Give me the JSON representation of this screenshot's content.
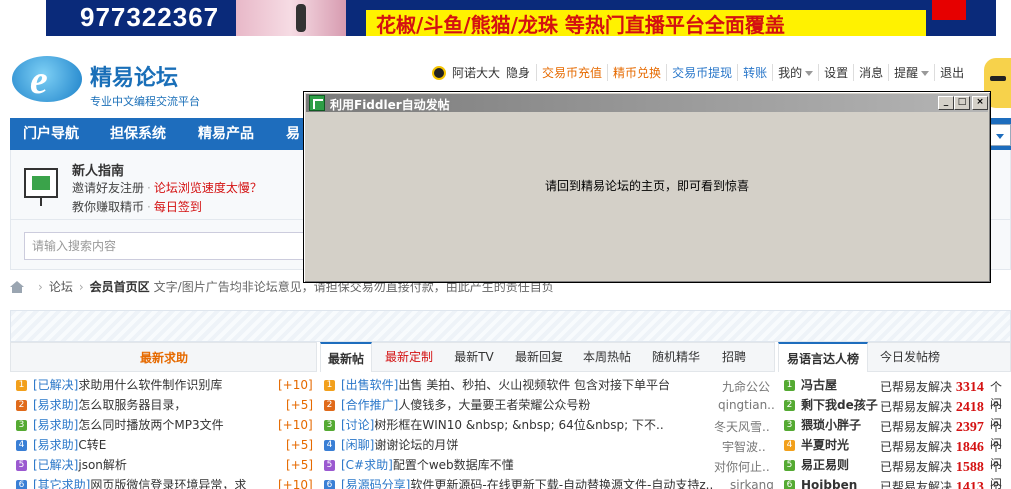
{
  "banner": {
    "phone": "977322367",
    "slogan": "花椒/斗鱼/熊猫/龙珠  等热门直播平台全面覆盖"
  },
  "header": {
    "logo_name": "精易论坛",
    "logo_tagline": "专业中文编程交流平台",
    "username": "阿诺大大",
    "invisible": "隐身",
    "links": [
      "交易币充值",
      "精币兑换",
      "交易币提现",
      "转账",
      "我的",
      "设置",
      "消息",
      "提醒",
      "退出"
    ]
  },
  "nav": {
    "items": [
      "门户导航",
      "担保系统",
      "精易产品",
      "易"
    ]
  },
  "guide": {
    "title": "新人指南",
    "line1_a": "邀请好友注册",
    "line1_b": "论坛浏览速度太慢？",
    "line2_a": "教你赚取精币",
    "line2_b": "每日签到"
  },
  "search": {
    "placeholder": "请输入搜索内容"
  },
  "breadcrumb": {
    "forum": "论坛",
    "section": "会员首页区",
    "notice": "文字/图片广告均非论坛意见，请担保交易勿直接付款，由此产生的责任自负"
  },
  "left_panel": {
    "title": "最新求助",
    "rows": [
      {
        "tag": "[已解决]",
        "text": "求助用什么软件制作识别库",
        "pts": "[+10]"
      },
      {
        "tag": "[易求助]",
        "text": "怎么取服务器目录，",
        "pts": "[+5]"
      },
      {
        "tag": "[易求助]",
        "text": "怎么同时播放两个MP3文件",
        "pts": "[+10]"
      },
      {
        "tag": "[易求助]",
        "text": "C转E",
        "pts": "[+5]"
      },
      {
        "tag": "[已解决]",
        "text": "json解析",
        "pts": "[+5]"
      },
      {
        "tag": "[其它求助]",
        "text": "网页版微信登录环境异常，求",
        "pts": "[+10]"
      }
    ]
  },
  "middle_panel": {
    "tabs": [
      "最新帖",
      "最新定制",
      "最新TV",
      "最新回复",
      "本周热帖",
      "随机精华",
      "招聘"
    ],
    "rows": [
      {
        "tag": "[出售软件]",
        "text": "出售 美拍、秒拍、火山视频软件 包含对接下单平台",
        "author": "九命公公"
      },
      {
        "tag": "[合作推广]",
        "text": "人傻钱多，大量要王者荣耀公众号粉",
        "author": "qingtian.."
      },
      {
        "tag": "[讨论]",
        "text": "树形框在WIN10 &nbsp; &nbsp; 64位&nbsp; 下不..",
        "author": "冬天风雪.."
      },
      {
        "tag": "[闲聊]",
        "text": "谢谢论坛的月饼",
        "author": "宇智波.."
      },
      {
        "tag": "[C#求助]",
        "text": "配置个web数据库不懂",
        "author": "对你何止.."
      },
      {
        "tag": "[易源码分享]",
        "text": "软件更新源码-在线更新下载-自动替换源文件-自动支持z..",
        "author": "sirkang"
      }
    ]
  },
  "right_panel": {
    "tabs": [
      "易语言达人榜",
      "今日发帖榜"
    ],
    "solved_label": "已帮易友解决",
    "unit": "个问",
    "rows": [
      {
        "name": "冯古屋",
        "count": "3314"
      },
      {
        "name": "剩下我de孩子",
        "count": "2418"
      },
      {
        "name": "猥琐小胖子",
        "count": "2397"
      },
      {
        "name": "半夏时光",
        "count": "1846"
      },
      {
        "name": "易正易则",
        "count": "1588"
      },
      {
        "name": "Hoibben",
        "count": "1413"
      }
    ]
  },
  "dialog": {
    "title": "利用Fiddler自动发帖",
    "message": "请回到精易论坛的主页，即可看到惊喜",
    "min": "_",
    "max": "□",
    "close": "×"
  },
  "colors": {
    "nav_blue": "#1e6dbd",
    "accent_red": "#d41111",
    "accent_orange": "#e66a00",
    "dialog_gray": "#d4d0c8"
  }
}
